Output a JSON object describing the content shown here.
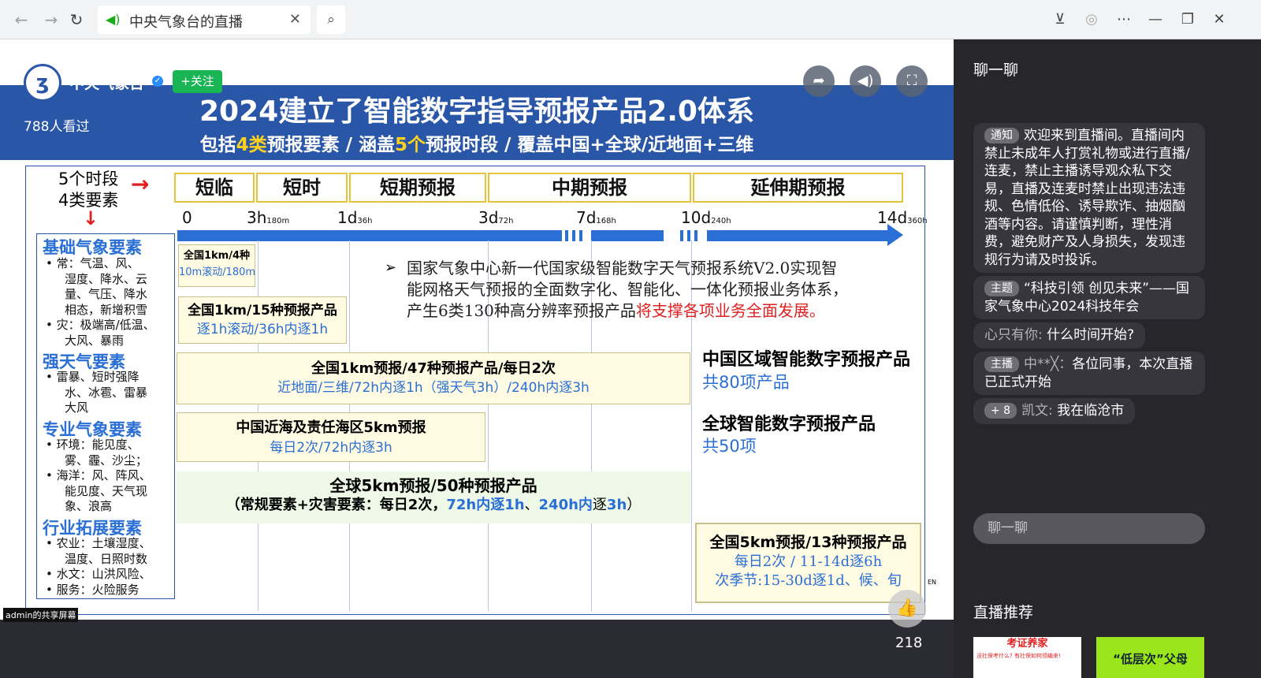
{
  "browser": {
    "tab_title": "中央气象台的直播"
  },
  "slide": {
    "title": "2024建立了智能数字指导预报产品2.0体系",
    "sub": {
      "a": "包括",
      "b": "4类",
      "c": "预报要素 / 涵盖",
      "d": "5个",
      "e": "预报时段 / 覆盖中国+全球/近地面+三维"
    },
    "left_hdr_1": "5个时段",
    "left_hdr_2": "4类要素",
    "phases": [
      "短临",
      "短时",
      "短期预报",
      "中期预报",
      "延伸期预报"
    ],
    "ticks": [
      {
        "main": "0",
        "sub": ""
      },
      {
        "main": "3h",
        "sub": "180m"
      },
      {
        "main": "1d",
        "sub": "36h"
      },
      {
        "main": "3d",
        "sub": "72h"
      },
      {
        "main": "7d",
        "sub": "168h"
      },
      {
        "main": "10d",
        "sub": "240h"
      },
      {
        "main": "14d",
        "sub": "360h"
      }
    ],
    "categories": [
      {
        "name": "基础气象要素",
        "items": [
          "常：气温、风、",
          "湿度、降水、云",
          "量、气压、降水",
          "相态，新增积雪",
          "灾：极端高/低温、",
          "大风、暴雨"
        ]
      },
      {
        "name": "强天气要素",
        "items": [
          "雷暴、短时强降",
          "水、冰雹、雷暴",
          "大风"
        ]
      },
      {
        "name": "专业气象要素",
        "items": [
          "环境：能见度、",
          "雾、霾、沙尘；",
          "海洋：风、阵风、",
          "能见度、天气现",
          "象、浪高"
        ]
      },
      {
        "name": "行业拓展要素",
        "items": [
          "农业：土壤湿度、",
          "温度、日照时数",
          "水文：山洪风险、",
          "服务：火险服务"
        ]
      }
    ],
    "box1": {
      "l1": "全国1km/4种",
      "l2": "10m滚动/180m"
    },
    "box2": {
      "l1": "全国1km/15种预报产品",
      "l2": "逐1h滚动/36h内逐1h"
    },
    "note": {
      "l1": "国家气象中心新一代国家级智能数字天气预报系统V2.0实现智",
      "l2": "能网格天气预报的全面数字化、智能化、一体化预报业务体系，",
      "l3a": "产生6类130种高分辨率预报产品",
      "l3b": "将支撑各项业务全面发展。"
    },
    "box3": {
      "l1": "全国1km预报/47种预报产品/每日2次",
      "l2": "近地面/三维/72h内逐1h（强天气3h）/240h内逐3h"
    },
    "box4": {
      "l1": "中国近海及责任海区5km预报",
      "l2": "每日2次/72h内逐3h"
    },
    "box5": {
      "l1": "全球5km预报/50种预报产品",
      "l2a": "（常规要素+灾害要素：每日2次，",
      "l2b": "72h内逐1h",
      "l2c": "、",
      "l2d": "240h内",
      "l2e": "逐",
      "l2f": "3h",
      "l2g": "）"
    },
    "right1": {
      "t": "中国区域智能数字预报产品",
      "s": "共80项产品"
    },
    "right2": {
      "t": "全球智能数字预报产品",
      "s": "共50项"
    },
    "box6": {
      "l1": "全国5km预报/13种预报产品",
      "l2": "每日2次 / 11-14d逐6h",
      "l3": "次季节:15-30d逐1d、候、旬"
    },
    "lang": "EN"
  },
  "stream": {
    "channel": "中央气象台",
    "follow": "+关注",
    "viewers": "788人看过",
    "likes": "218",
    "share_label": "admin的共享屏幕"
  },
  "chat": {
    "title": "聊一聊",
    "messages": [
      {
        "tag": "通知",
        "text": "欢迎来到直播间。直播间内禁止未成年人打赏礼物或进行直播/连麦，禁止主播诱导观众私下交易，直播及连麦时禁止出现违法违规、色情低俗、诱导欺诈、抽烟酗酒等内容。请谨慎判断，理性消费，避免财产及人身损失，发现违规行为请及时投诉。"
      },
      {
        "tag": "主题",
        "text": "“科技引领 创见未来”——国家气象中心2024科技年会"
      },
      {
        "user": "心只有你:",
        "text": "什么时间开始?"
      },
      {
        "tag": "主播",
        "user": "中**╳：",
        "text": "各位同事，本次直播已正式开始"
      },
      {
        "tag": "+ 8",
        "user": "凯文:",
        "text": "我在临沧市"
      }
    ],
    "input_placeholder": "聊一聊",
    "recommend_title": "直播推荐",
    "rec1": {
      "t": "考证养家",
      "s": "没社保考什么? 有社保如何领编来!"
    },
    "rec2": {
      "t": "“低层次”父母"
    }
  }
}
